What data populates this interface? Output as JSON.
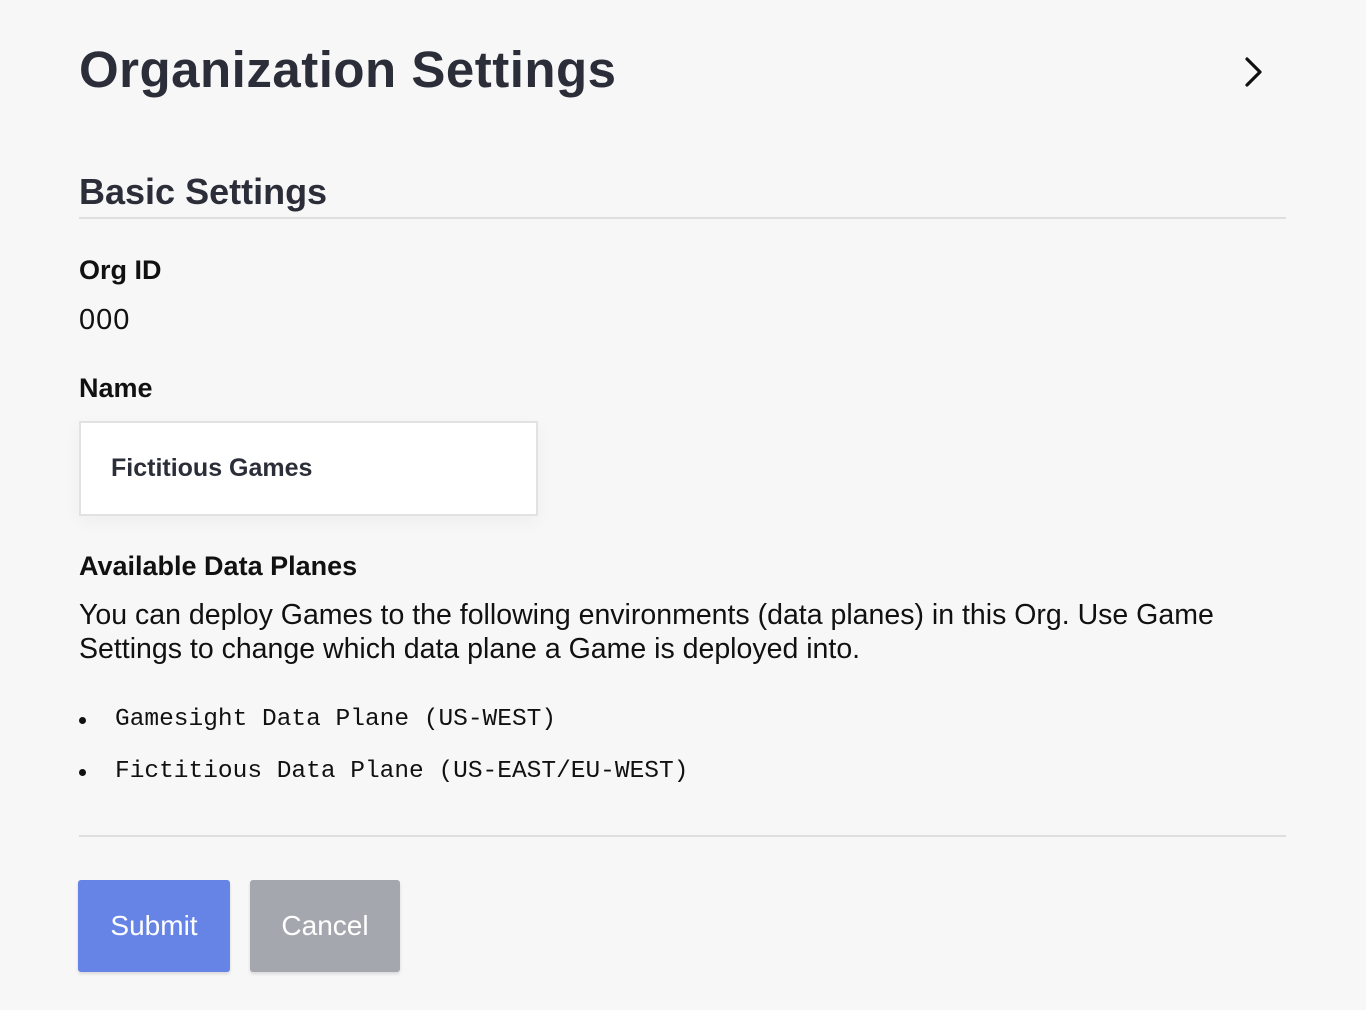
{
  "header": {
    "title": "Organization Settings",
    "close_icon": "chevron-right-icon"
  },
  "basic_settings": {
    "title": "Basic Settings",
    "org_id": {
      "label": "Org ID",
      "value": "000"
    },
    "name": {
      "label": "Name",
      "value": "Fictitious Games"
    },
    "data_planes": {
      "label": "Available Data Planes",
      "description": "You can deploy Games to the following environments (data planes) in this Org. Use Game Settings to change which data plane a Game is deployed into.",
      "items": [
        "Gamesight Data Plane (US-WEST)",
        "Fictitious Data Plane (US-EAST/EU-WEST)"
      ]
    }
  },
  "actions": {
    "submit_label": "Submit",
    "cancel_label": "Cancel"
  },
  "colors": {
    "background": "#f7f7f7",
    "heading": "#2b2d38",
    "submit": "#6683e6",
    "cancel": "#a5a7ae"
  }
}
